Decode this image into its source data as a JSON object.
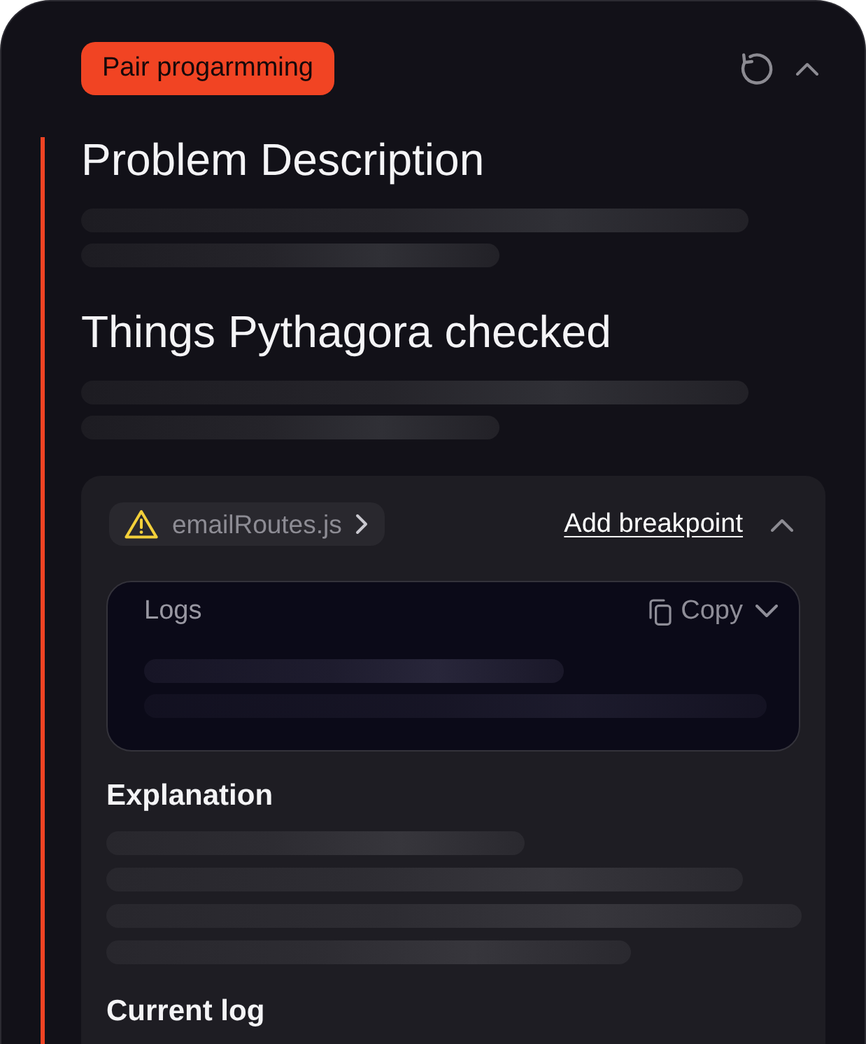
{
  "header": {
    "badge": "Pair progarmming",
    "expanded": true
  },
  "sections": [
    {
      "title": "Problem Description",
      "loading": true
    },
    {
      "title": "Things Pythagora checked",
      "loading": true
    }
  ],
  "check_card": {
    "file_chip": {
      "warning": true,
      "filename": "emailRoutes.js"
    },
    "link": "Add breakpoint",
    "expanded": true,
    "logs": {
      "title": "Logs",
      "copy_button": "Copy",
      "loading": true
    },
    "subsections": [
      {
        "title": "Explanation",
        "loading": true
      },
      {
        "title": "Current log"
      }
    ]
  }
}
